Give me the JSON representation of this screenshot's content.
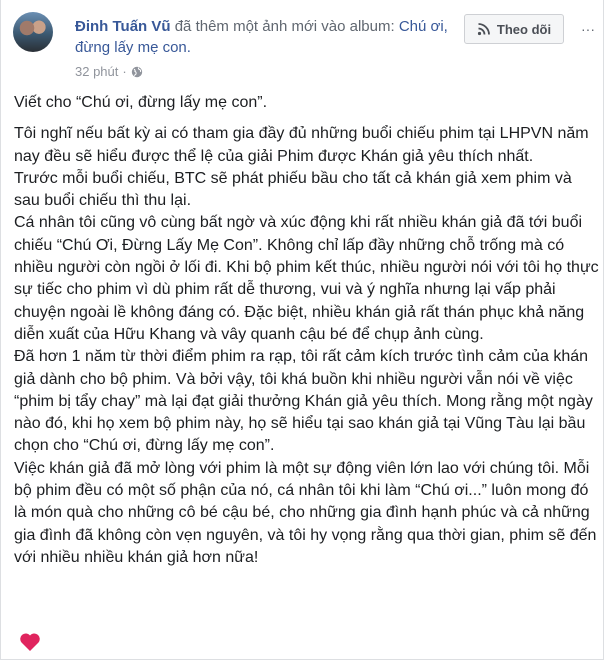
{
  "header": {
    "author": "Đinh Tuấn Vũ",
    "action_text": " đã thêm một ảnh mới vào album: ",
    "album": "Chú ơi, đừng lấy mẹ con.",
    "time": "32 phút",
    "separator": "·",
    "follow_label": "Theo dõi",
    "more_label": "···"
  },
  "post": {
    "intro": "Viết cho “Chú ơi, đừng lấy mẹ con”.",
    "paragraphs": [
      "Tôi nghĩ nếu bất kỳ ai có tham gia đầy đủ những buổi chiếu phim tại LHPVN năm nay đều sẽ hiểu được thể lệ của giải Phim được Khán giả yêu thích nhất.",
      "Trước mỗi buổi chiếu, BTC sẽ phát phiếu bầu cho tất cả khán giả xem phim và sau buổi chiếu thì thu lại.",
      "Cá nhân tôi cũng vô cùng bất ngờ và xúc động khi rất nhiều khán giả đã tới buổi chiếu “Chú Ơi, Đừng Lấy Mẹ Con”. Không chỉ lấp đầy những chỗ trống mà có nhiều người còn ngồi ở lối đi. Khi bộ phim kết thúc, nhiều người nói với tôi họ thực sự tiếc cho phim vì dù phim rất dễ thương, vui và ý nghĩa nhưng lại vấp phải chuyện ngoài lề không đáng có. Đặc biệt, nhiều khán giả rất thán phục khả năng diễn xuất của Hữu Khang và vây quanh cậu bé để chụp ảnh cùng.",
      "Đã hơn 1 năm từ thời điểm phim ra rạp, tôi rất cảm kích trước tình cảm của khán giả dành cho bộ phim. Và bởi vậy, tôi khá buồn khi nhiều người vẫn nói về việc “phim bị tẩy chay” mà lại đạt giải thưởng Khán giả yêu thích. Mong rằng một ngày nào đó, khi họ xem bộ phim này, họ sẽ hiểu tại sao khán giả tại Vũng Tàu lại bầu chọn cho “Chú ơi, đừng lấy mẹ con”.",
      "Việc khán giả đã mở lòng với phim là một sự động viên lớn lao với chúng tôi. Mỗi bộ phim đều có một số phận của nó, cá nhân tôi khi làm “Chú ơi...” luôn mong đó là món quà cho những cô bé cậu bé, cho những gia đình hạnh phúc và cả những gia đình đã không còn vẹn nguyên, và tôi hy vọng rằng qua thời gian, phim sẽ đến với nhiều nhiều khán giả hơn nữa!"
    ]
  },
  "colors": {
    "link": "#385898",
    "meta": "#90949c",
    "heart": "#e0245e"
  },
  "icons": {
    "avatar": "avatar-photo",
    "privacy": "globe-icon",
    "follow": "rss-icon",
    "end": "heart-icon"
  }
}
